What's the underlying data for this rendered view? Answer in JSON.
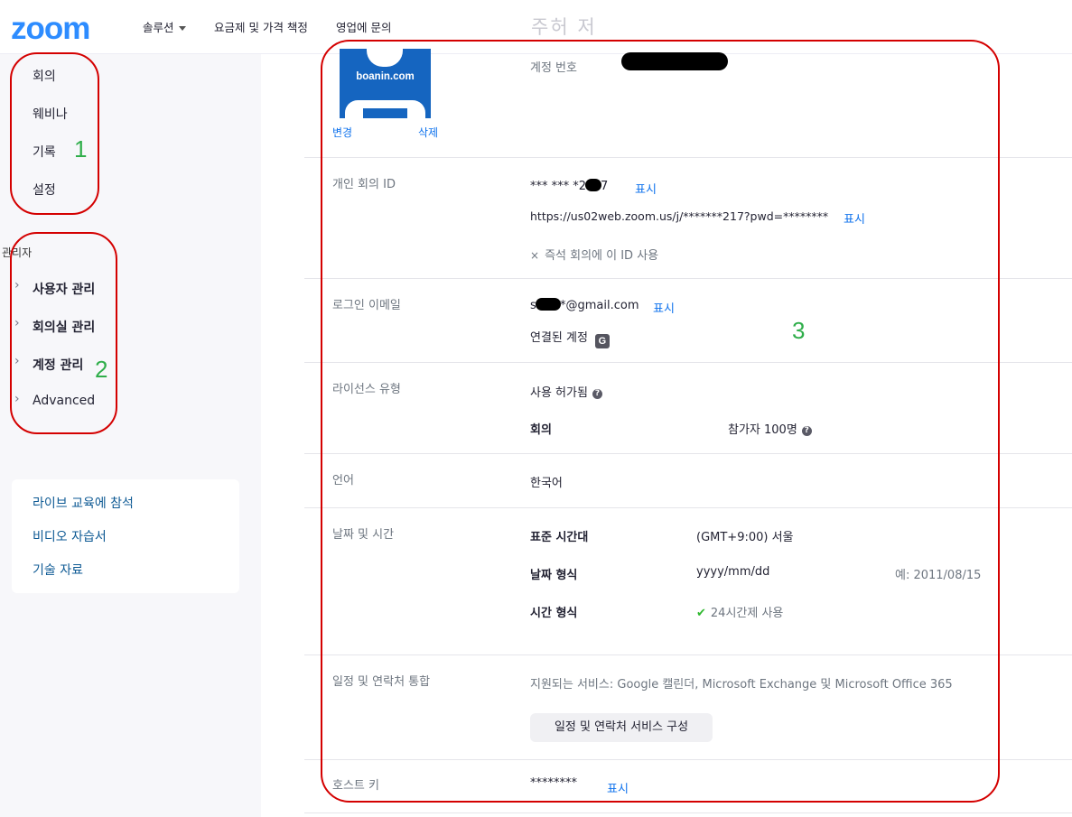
{
  "header": {
    "logo": "zoom",
    "nav": [
      {
        "label": "솔루션"
      },
      {
        "label": "요금제 및 가격 책정"
      },
      {
        "label": "영업에 문의"
      }
    ],
    "ghost_title": "주허 저"
  },
  "sidebar": {
    "personal_items": [
      "회의",
      "웨비나",
      "기록",
      "설정"
    ],
    "admin_header": "관리자",
    "admin_items": [
      "사용자 관리",
      "회의실 관리",
      "계정 관리",
      "Advanced"
    ],
    "help_links": [
      "라이브 교육에 참석",
      "비디오 자습서",
      "기술 자료"
    ]
  },
  "annotations": {
    "one": "1",
    "two": "2",
    "three": "3"
  },
  "profile": {
    "avatar_text": "boanin.com",
    "change": "변경",
    "delete": "삭제",
    "account_no_label": "계정 번호",
    "pmi_label": "개인 회의 ID",
    "pmi_value": "*** *** *2",
    "pmi_value_tail": "7",
    "show": "표시",
    "pmi_url": "https://us02web.zoom.us/j/*******217?pwd=********",
    "instant_meeting": "즉석 회의에 이 ID 사용",
    "email_label": "로그인 이메일",
    "email_prefix": "s",
    "email_value": "*@gmail.com",
    "linked_account": "연결된 계정",
    "google_icon": "G",
    "license_label": "라이선스 유형",
    "license_value": "사용 허가됨",
    "meeting": "회의",
    "participants": "참가자 100명",
    "language_label": "언어",
    "language_value": "한국어",
    "datetime_label": "날짜 및 시간",
    "timezone_label": "표준 시간대",
    "timezone_value": "(GMT+9:00) 서울",
    "date_format_label": "날짜 형식",
    "date_format_value": "yyyy/mm/dd",
    "date_example": "예: 2011/08/15",
    "time_format_label": "시간 형식",
    "time_format_value": "24시간제 사용",
    "calendar_label": "일정 및 연락처 통합",
    "calendar_services": "지원되는 서비스: Google 캘린더, Microsoft Exchange 및 Microsoft Office 365",
    "calendar_button": "일정 및 연락처 서비스 구성",
    "host_key_label": "호스트 키",
    "host_key_value": "********"
  }
}
